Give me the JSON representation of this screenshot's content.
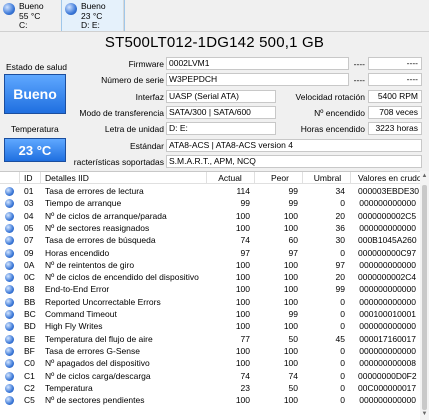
{
  "disks": [
    {
      "status": "Bueno",
      "temp": "55 °C",
      "letter": "C:"
    },
    {
      "status": "Bueno",
      "temp": "23 °C",
      "letter": "D: E:"
    }
  ],
  "title": "ST500LT012-1DG142 500,1 GB",
  "health": {
    "label": "Estado de salud",
    "value": "Bueno"
  },
  "temperature": {
    "label": "Temperatura",
    "value": "23 °C"
  },
  "info": {
    "firmware_label": "Firmware",
    "firmware": "0002LVM1",
    "serial_label": "Número de serie",
    "serial": "W3PEPDCH",
    "interface_label": "Interfaz",
    "interface": "UASP (Serial ATA)",
    "transfer_label": "Modo de transferencia",
    "transfer": "SATA/300 | SATA/600",
    "drive_letter_label": "Letra de unidad",
    "drive_letter": "D: E:",
    "standard_label": "Estándar",
    "standard": "ATA8-ACS | ATA8-ACS version 4",
    "features_label": "racterísticas soportadas",
    "features": "S.M.A.R.T., APM, NCQ",
    "right_top1": "----",
    "right_top1b": "----",
    "right_top2": "----",
    "right_top2b": "----",
    "rotation_label": "Velocidad rotación",
    "rotation": "5400 RPM",
    "power_count_label": "Nº encendido",
    "power_count": "708 veces",
    "power_hours_label": "Horas encendido",
    "power_hours": "3223 horas"
  },
  "table": {
    "headers": {
      "id": "ID",
      "name": "Detalles IID",
      "current": "Actual",
      "worst": "Peor",
      "threshold": "Umbral",
      "raw": "Valores en crudo"
    },
    "rows": [
      {
        "id": "01",
        "name": "Tasa de errores de lectura",
        "current": "114",
        "worst": "99",
        "threshold": "34",
        "raw": "000003EBDE30"
      },
      {
        "id": "03",
        "name": "Tiempo de arranque",
        "current": "99",
        "worst": "99",
        "threshold": "0",
        "raw": "000000000000"
      },
      {
        "id": "04",
        "name": "Nº de ciclos de arranque/parada",
        "current": "100",
        "worst": "100",
        "threshold": "20",
        "raw": "0000000002C5"
      },
      {
        "id": "05",
        "name": "Nº de sectores reasignados",
        "current": "100",
        "worst": "100",
        "threshold": "36",
        "raw": "000000000000"
      },
      {
        "id": "07",
        "name": "Tasa de errores de búsqueda",
        "current": "74",
        "worst": "60",
        "threshold": "30",
        "raw": "000B1045A260"
      },
      {
        "id": "09",
        "name": "Horas encendido",
        "current": "97",
        "worst": "97",
        "threshold": "0",
        "raw": "000000000C97"
      },
      {
        "id": "0A",
        "name": "Nº de reintentos de giro",
        "current": "100",
        "worst": "100",
        "threshold": "97",
        "raw": "000000000000"
      },
      {
        "id": "0C",
        "name": "Nº de ciclos de encendido del dispositivo",
        "current": "100",
        "worst": "100",
        "threshold": "20",
        "raw": "0000000002C4"
      },
      {
        "id": "B8",
        "name": "End-to-End Error",
        "current": "100",
        "worst": "100",
        "threshold": "99",
        "raw": "000000000000"
      },
      {
        "id": "BB",
        "name": "Reported Uncorrectable Errors",
        "current": "100",
        "worst": "100",
        "threshold": "0",
        "raw": "000000000000"
      },
      {
        "id": "BC",
        "name": "Command Timeout",
        "current": "100",
        "worst": "99",
        "threshold": "0",
        "raw": "000100010001"
      },
      {
        "id": "BD",
        "name": "High Fly Writes",
        "current": "100",
        "worst": "100",
        "threshold": "0",
        "raw": "000000000000"
      },
      {
        "id": "BE",
        "name": "Temperatura del flujo de aire",
        "current": "77",
        "worst": "50",
        "threshold": "45",
        "raw": "000017160017"
      },
      {
        "id": "BF",
        "name": "Tasa de errores G-Sense",
        "current": "100",
        "worst": "100",
        "threshold": "0",
        "raw": "000000000000"
      },
      {
        "id": "C0",
        "name": "Nº apagados del dispositivo",
        "current": "100",
        "worst": "100",
        "threshold": "0",
        "raw": "000000000008"
      },
      {
        "id": "C1",
        "name": "Nº de ciclos carga/descarga",
        "current": "74",
        "worst": "74",
        "threshold": "0",
        "raw": "00000000D0F2"
      },
      {
        "id": "C2",
        "name": "Temperatura",
        "current": "23",
        "worst": "50",
        "threshold": "0",
        "raw": "00C000000017"
      },
      {
        "id": "C5",
        "name": "Nº de sectores pendientes",
        "current": "100",
        "worst": "100",
        "threshold": "0",
        "raw": "000000000000"
      }
    ]
  },
  "colors": {
    "health": "#2f80ed",
    "status_dot": "#3b78d8"
  }
}
